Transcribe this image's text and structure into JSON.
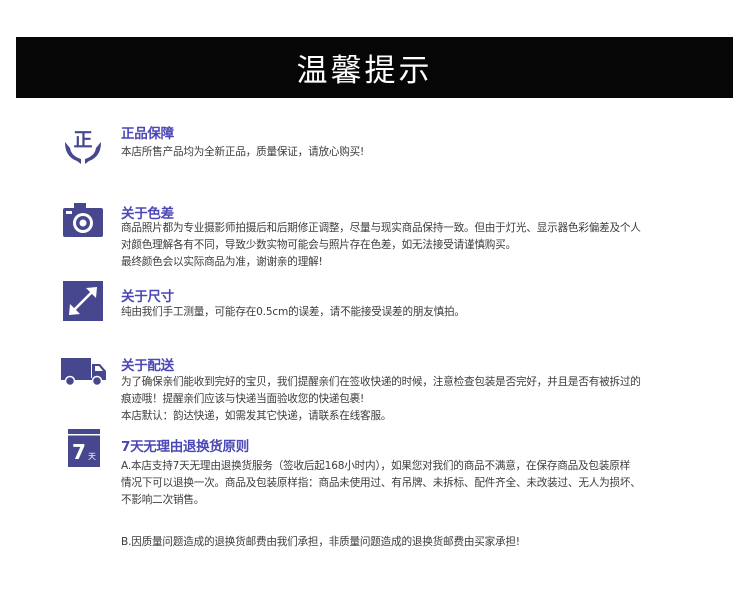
{
  "banner": {
    "title": "温馨提示"
  },
  "sections": {
    "genuine": {
      "icon": "genuine-guarantee-icon",
      "title": "正品保障",
      "lines": [
        "本店所售产品均为全新正品，质量保证，请放心购买!"
      ]
    },
    "color": {
      "icon": "camera-icon",
      "title": "关于色差",
      "lines": [
        "商品照片都为专业摄影师拍摄后和后期修正调整，尽量与现实商品保持一致。但由于灯光、显示器色彩偏差及个人",
        "对颜色理解各有不同，导致少数实物可能会与照片存在色差，如无法接受请谨慎购买。",
        "最终颜色会以实际商品为准，谢谢亲的理解!"
      ]
    },
    "size": {
      "icon": "resize-arrow-icon",
      "title": "关于尺寸",
      "lines": [
        "纯由我们手工测量，可能存在0.5cm的误差，请不能接受误差的朋友慎拍。"
      ]
    },
    "delivery": {
      "icon": "delivery-truck-icon",
      "title": "关于配送",
      "lines": [
        "为了确保亲们能收到完好的宝贝，我们提醒亲们在签收快递的时候，注意检查包装是否完好，并且是否有被拆过的",
        "痕迹哦！提醒亲们应该与快递当面验收您的快递包裹!",
        "本店默认：韵达快递，如需发其它快递，请联系在线客服。"
      ]
    },
    "returns": {
      "icon": "calendar-7-days-icon",
      "icon_number": "7",
      "icon_unit": "天",
      "title": "7天无理由退换货原则",
      "lines_a": [
        "A.本店支持7天无理由退换货服务（签收后起168小时内），如果您对我们的商品不满意，在保存商品及包装原样",
        "情况下可以退换一次。商品及包装原样指：商品未使用过、有吊牌、未拆标、配件齐全、未改装过、无人为损坏、",
        "不影响二次销售。"
      ],
      "lines_b": [
        "B.因质量问题造成的退换货邮费由我们承担，非质量问题造成的退换货邮费由买家承担!"
      ]
    }
  },
  "colors": {
    "accent": "#4b47b6",
    "icon": "#47478f",
    "banner": "#060606",
    "text": "#3c3c3c"
  }
}
